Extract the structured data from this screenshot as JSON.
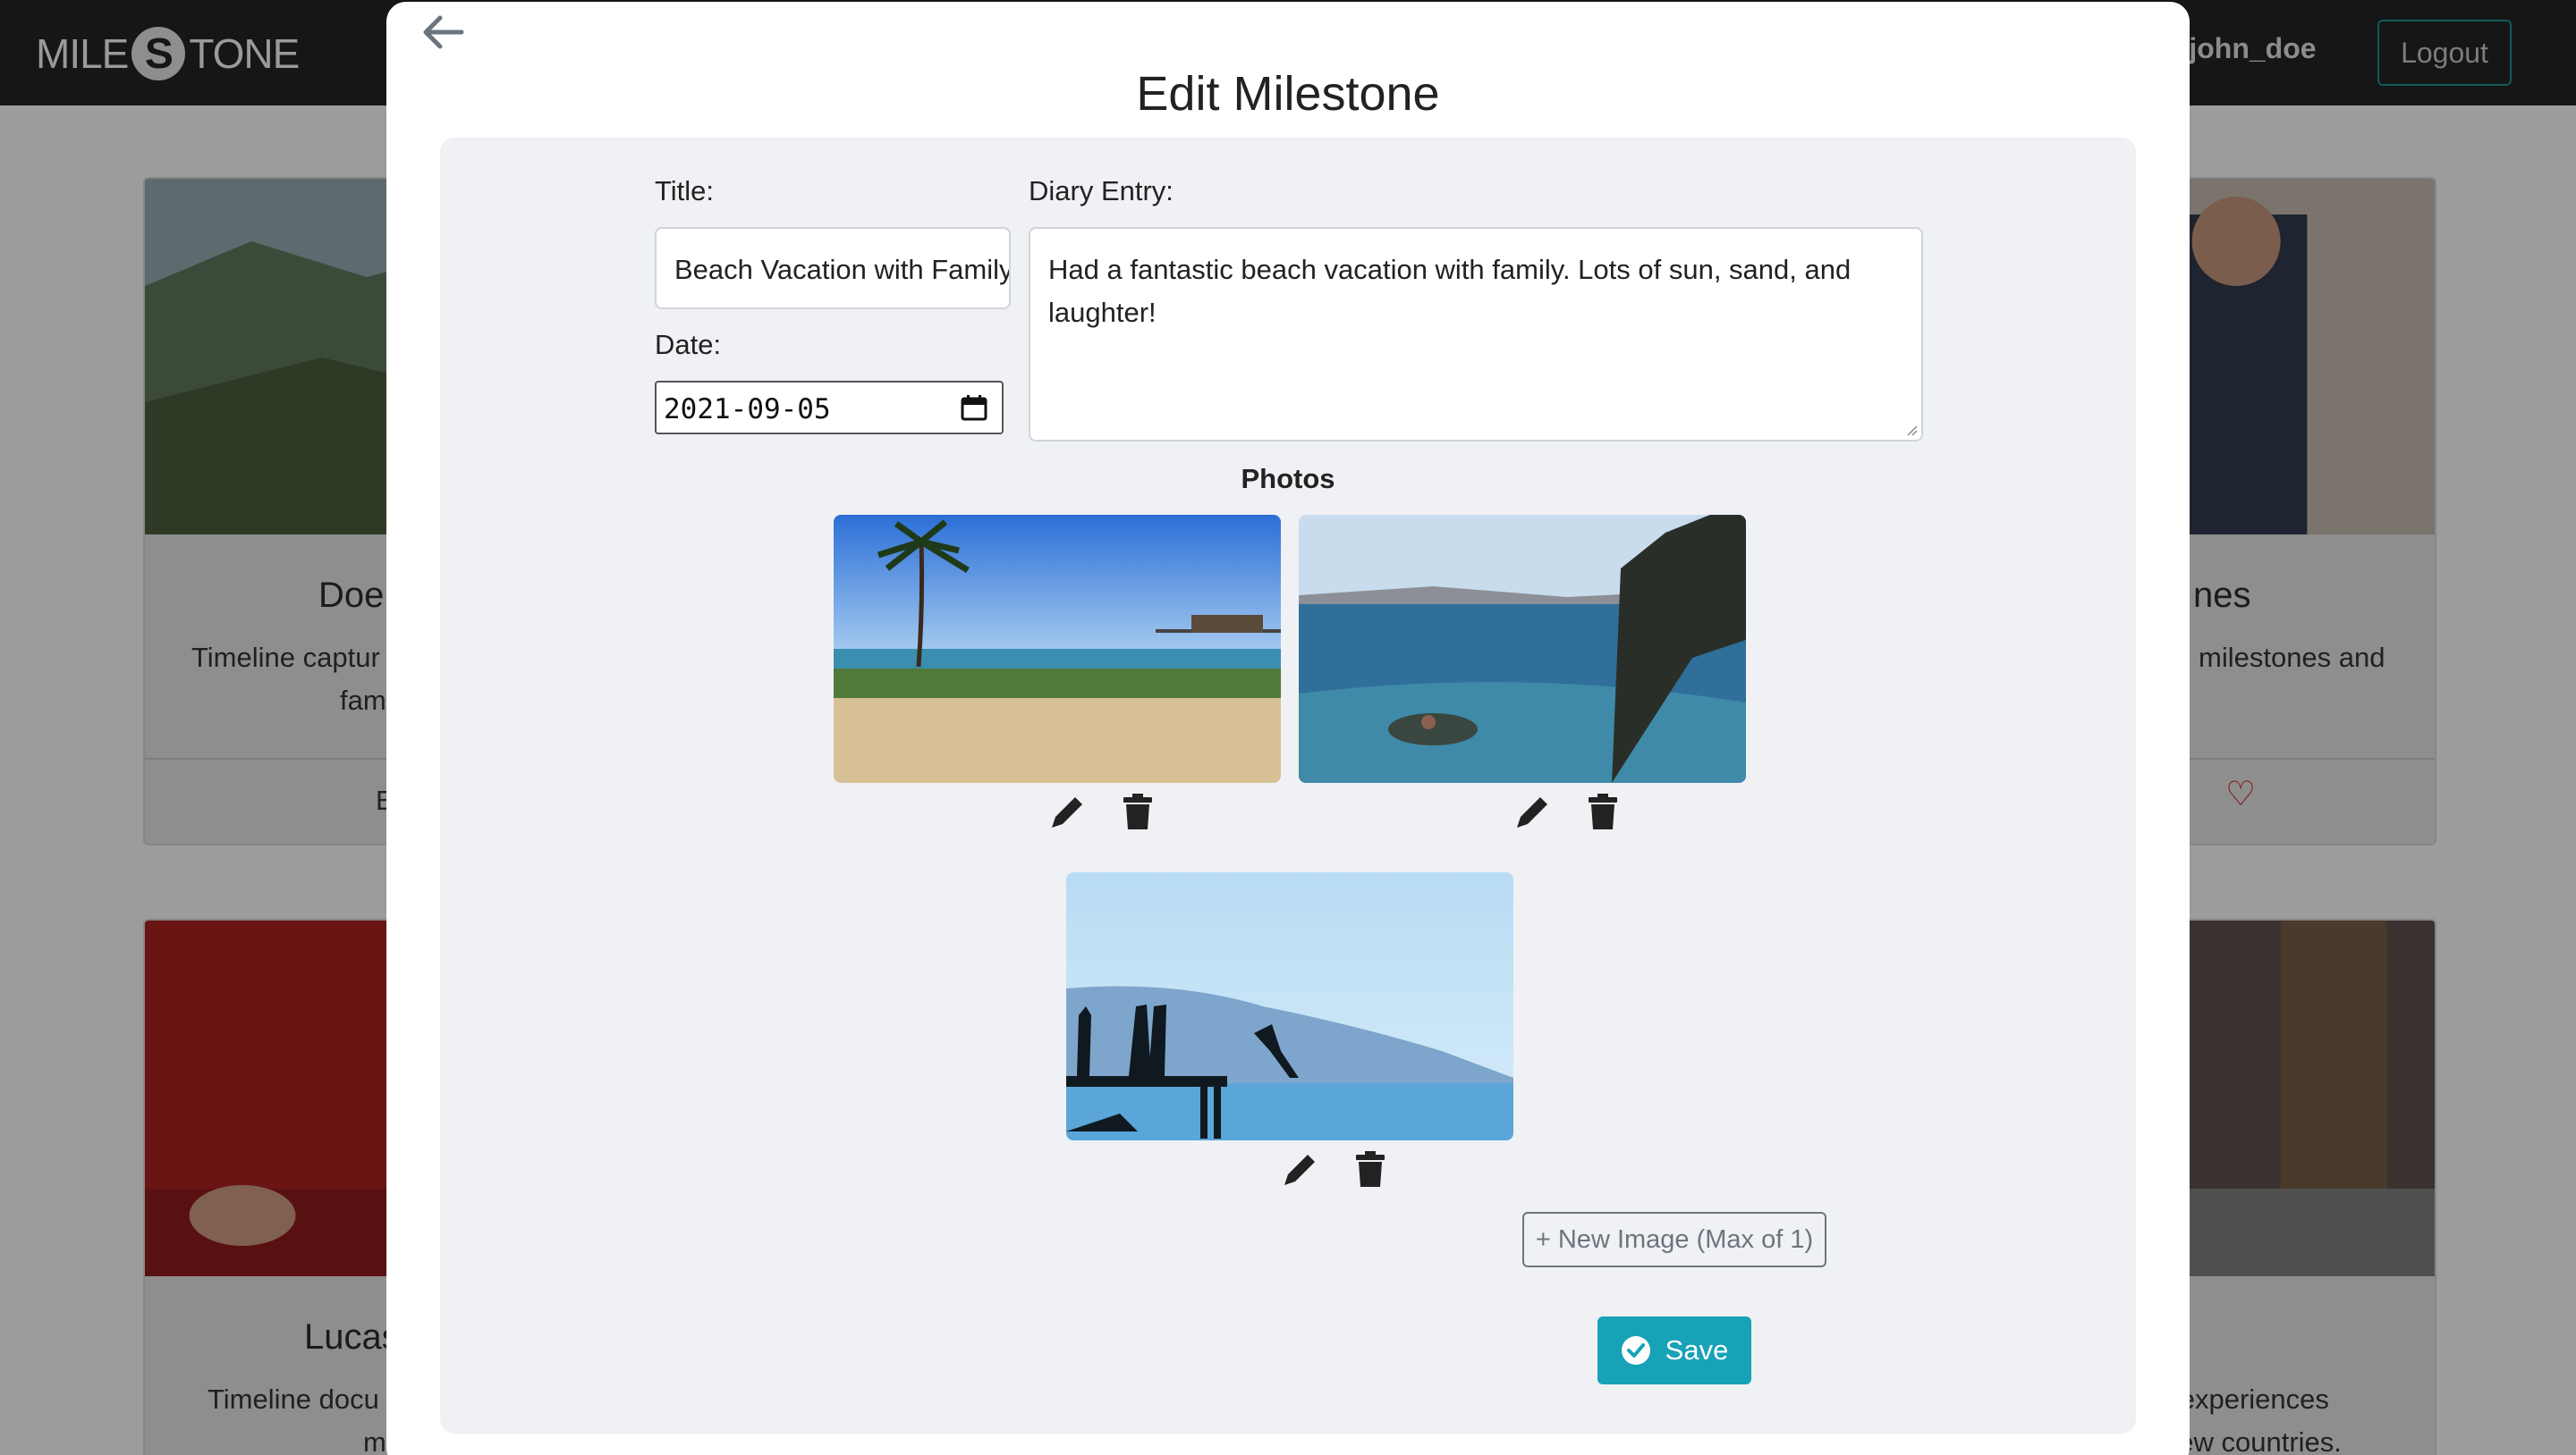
{
  "navbar": {
    "logo_left": "MILE",
    "logo_mark": "S",
    "logo_right": "TONE",
    "user_label": "o, john_doe",
    "logout_label": "Logout"
  },
  "background_cards": [
    {
      "title": "Doe",
      "text_line1": "Timeline captur",
      "text_line2": "fam",
      "footer": "E"
    },
    {
      "title": "nes",
      "text_line1": "milestones and",
      "text_line2": ""
    },
    {
      "title": "Lucas",
      "text_line1": "Timeline docu",
      "text_line2": "m"
    },
    {
      "title": "",
      "text_line1": "el experiences",
      "text_line2": "new countries."
    }
  ],
  "modal": {
    "title": "Edit Milestone",
    "form": {
      "title_label": "Title:",
      "title_value": "Beach Vacation with Family",
      "date_label": "Date:",
      "date_value": "2021-09-05",
      "diary_label": "Diary Entry:",
      "diary_value": "Had a fantastic beach vacation with family. Lots of sun, sand, and laughter!"
    },
    "photos_heading": "Photos",
    "photos": [
      {
        "description": "beach with palm tree and pier"
      },
      {
        "description": "swimmer in sea near cliff"
      },
      {
        "description": "silhouettes jumping off pier"
      }
    ],
    "new_image_label": "+ New Image (Max of 1)",
    "save_label": "Save"
  },
  "colors": {
    "accent": "#17a2b8",
    "navbar": "#161616",
    "panel": "#f0f1f5",
    "overlay": "#9c9c9c"
  },
  "icons": [
    "arrow-left-icon",
    "calendar-icon",
    "pencil-icon",
    "trash-icon",
    "check-circle-icon",
    "heart-icon"
  ]
}
